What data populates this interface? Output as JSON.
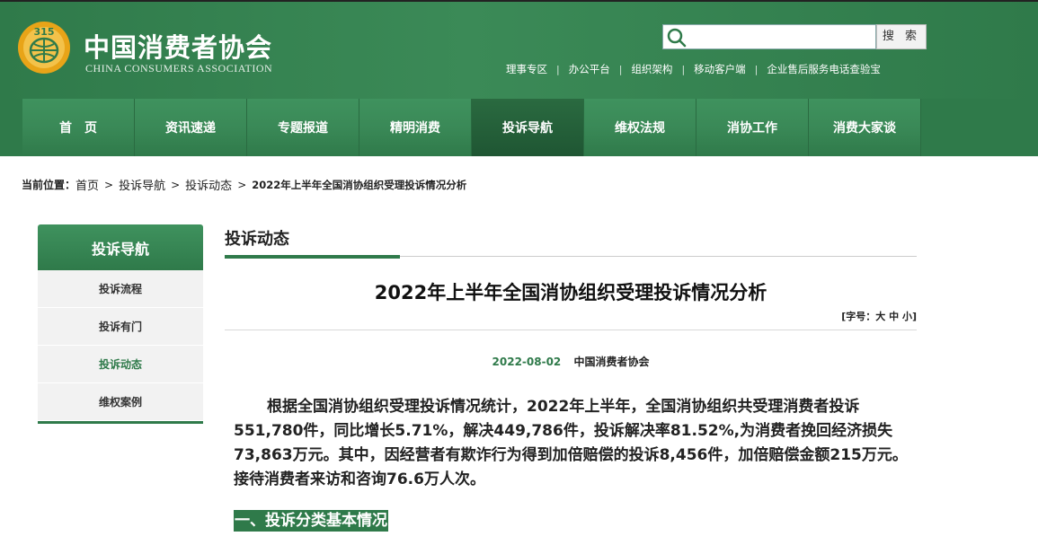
{
  "header": {
    "site_name": "中国消费者协会",
    "site_sub": "CHINA CONSUMERS ASSOCIATION",
    "search": {
      "placeholder": "",
      "button": "搜 索"
    },
    "top_links": [
      "理事专区",
      "办公平台",
      "组织架构",
      "移动客户端",
      "企业售后服务电话查验宝"
    ],
    "logo_icon": "cca-emblem-icon"
  },
  "nav": {
    "items": [
      "首　页",
      "资讯速递",
      "专题报道",
      "精明消费",
      "投诉导航",
      "维权法规",
      "消协工作",
      "消费大家谈"
    ],
    "active_index": 4
  },
  "breadcrumb": {
    "label": "当前位置：",
    "items": [
      "首页",
      "投诉导航",
      "投诉动态"
    ],
    "current": "2022年上半年全国消协组织受理投诉情况分析",
    "separator": ">"
  },
  "sidebar": {
    "title": "投诉导航",
    "items": [
      "投诉流程",
      "投诉有门",
      "投诉动态",
      "维权案例"
    ],
    "active_index": 2
  },
  "article": {
    "section_title": "投诉动态",
    "title": "2022年上半年全国消协组织受理投诉情况分析",
    "font_size_label": "[字号：大 中 小]",
    "date": "2022-08-02",
    "org": "中国消费者协会",
    "paragraph": "根据全国消协组织受理投诉情况统计，2022年上半年，全国消协组织共受理消费者投诉551,780件，同比增长5.71%，解决449,786件，投诉解决率81.52%,为消费者挽回经济损失73,863万元。其中，因经营者有欺诈行为得到加倍赔偿的投诉8,456件，加倍赔偿金额215万元。接待消费者来访和咨询76.6万人次。",
    "heading_1": "一、投诉分类基本情况"
  },
  "colors": {
    "brand_green": "#2f7a4a",
    "date_green": "#2f7a4a"
  }
}
